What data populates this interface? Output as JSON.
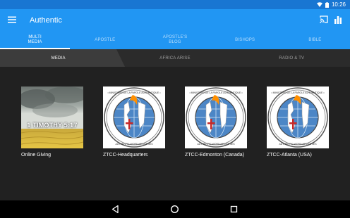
{
  "status_bar": {
    "time": "10:26",
    "icons": [
      "wifi-icon",
      "battery-icon"
    ]
  },
  "app_bar": {
    "title": "Authentic",
    "icons": [
      "menu-icon",
      "cast-icon",
      "bar-chart-icon"
    ]
  },
  "tabs": [
    {
      "label": "MULTI MEDIA",
      "active": true
    },
    {
      "label": "APOSTLE",
      "active": false
    },
    {
      "label": "APOSTLE'S BLOG",
      "active": false
    },
    {
      "label": "BISHOPS",
      "active": false
    },
    {
      "label": "BIBLE",
      "active": false
    }
  ],
  "subtabs": [
    {
      "label": "MEDIA",
      "active": true
    },
    {
      "label": "AFRICA ARISE",
      "active": false
    },
    {
      "label": "RADIO & TV",
      "active": false
    }
  ],
  "cards": [
    {
      "label": "Online Giving",
      "thumb_text": "1 TIMOTHY 5:17"
    },
    {
      "label": "ZTCC-Headquarters",
      "thumb_text": ""
    },
    {
      "label": "ZTCC-Edmonton (Canada)",
      "thumb_text": ""
    },
    {
      "label": "ZTCC-Atlanta (USA)",
      "thumb_text": ""
    }
  ],
  "nav_bar": {
    "icons": [
      "back-icon",
      "home-icon",
      "recents-icon"
    ]
  },
  "colors": {
    "primary": "#2196f3",
    "status": "#1976d2",
    "background": "#212121",
    "accent_red": "#c62828",
    "accent_orange": "#ff8f00"
  }
}
